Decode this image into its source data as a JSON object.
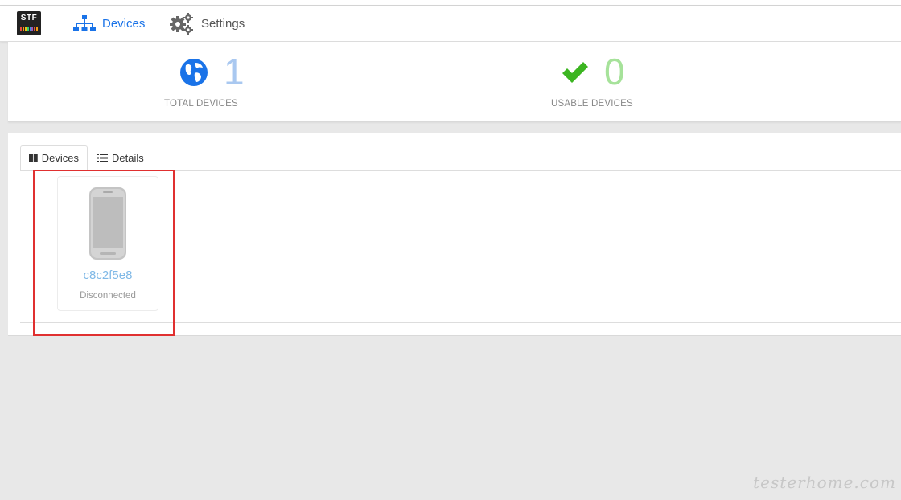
{
  "app": {
    "logo_text": "STF"
  },
  "nav": {
    "devices_label": "Devices",
    "settings_label": "Settings"
  },
  "stats": {
    "total": {
      "value": "1",
      "label": "TOTAL DEVICES",
      "icon": "globe-icon",
      "color": "#1a73e8"
    },
    "usable": {
      "value": "0",
      "label": "USABLE DEVICES",
      "icon": "checkmark-icon",
      "color": "#3cb521"
    }
  },
  "tabs": {
    "devices_label": "Devices",
    "details_label": "Details"
  },
  "devices": [
    {
      "serial": "c8c2f5e8",
      "status": "Disconnected"
    }
  ],
  "watermark": "testerhome.com",
  "colors": {
    "accent": "#1a73e8",
    "success": "#3cb521",
    "highlight": "#e03030"
  }
}
